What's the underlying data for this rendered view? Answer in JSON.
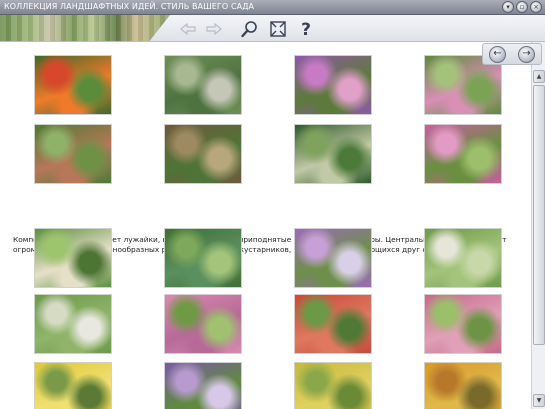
{
  "window": {
    "title": "КОЛЛЕКЦИЯ ЛАНДШАФТНЫХ ИДЕЙ. СТИЛЬ ВАШЕГО САДА",
    "controls": [
      {
        "name": "minimize-button",
        "glyph": "▾"
      },
      {
        "name": "restore-button",
        "glyph": "▫"
      },
      {
        "name": "close-button",
        "glyph": "×"
      }
    ]
  },
  "toolbar": {
    "tools": [
      {
        "name": "back-arrow-icon",
        "glyph": "⇦"
      },
      {
        "name": "forward-arrow-icon",
        "glyph": "⇨"
      },
      {
        "name": "zoom-magnifier-icon"
      },
      {
        "name": "fullscreen-icon"
      },
      {
        "name": "help-question-icon",
        "glyph": "?"
      }
    ]
  },
  "navigation": {
    "prev_glyph": "←",
    "next_glyph": "→"
  },
  "description": "Композиция сада включает лужайки, водоем с лилиями, приподнятые клумбы, миксбордеры. Центральную часть наполняет огромное количество разнообразных растений, цветов и кустарников, гармонично сочетающихся друг с другом.",
  "gallery": {
    "top_rows": [
      [
        {
          "name": "photo-red-hot-pokers",
          "colors": [
            "#3f6a2a",
            "#d9472b",
            "#f07a2a",
            "#5b8c3a"
          ]
        },
        {
          "name": "photo-garden-pond",
          "colors": [
            "#6f8f55",
            "#a8b892",
            "#4f7340",
            "#c5c7b6"
          ]
        },
        {
          "name": "photo-pink-asters",
          "colors": [
            "#8d5aa8",
            "#c77bc4",
            "#5d7a3a",
            "#e0a0c8"
          ]
        },
        {
          "name": "photo-border-lawn",
          "colors": [
            "#5f8a3f",
            "#a5c27a",
            "#d98fb6",
            "#7aa356"
          ]
        }
      ],
      [
        {
          "name": "photo-box-hedge-parterre",
          "colors": [
            "#4f7a35",
            "#8fb26a",
            "#b77758",
            "#6d9246"
          ]
        },
        {
          "name": "photo-raised-beds",
          "colors": [
            "#6e5a3c",
            "#9e8a62",
            "#4f7436",
            "#b8a77e"
          ]
        },
        {
          "name": "photo-cypress-pond",
          "colors": [
            "#2f5a2e",
            "#7fa35c",
            "#c2c9a6",
            "#4d7a3a"
          ]
        },
        {
          "name": "photo-flower-mixborder",
          "colors": [
            "#c75ea0",
            "#e39ac4",
            "#6a8f40",
            "#9cbf6c"
          ]
        }
      ]
    ],
    "bottom_rows": [
      [
        {
          "name": "photo-grass-path-border",
          "colors": [
            "#5d8f3f",
            "#9cc56e",
            "#e6e0c8",
            "#4c7433"
          ]
        },
        {
          "name": "photo-waterside-planting",
          "colors": [
            "#3f6f33",
            "#7ea85a",
            "#5a8f5f",
            "#a3c47a"
          ]
        },
        {
          "name": "photo-allium-border",
          "colors": [
            "#9a6bb8",
            "#c8a0d8",
            "#6e8f4a",
            "#d8d0e6"
          ]
        },
        {
          "name": "photo-white-perennials",
          "colors": [
            "#6e9a48",
            "#e6e6d8",
            "#a3c47a",
            "#c8d8a8"
          ]
        }
      ],
      [
        {
          "name": "photo-lawn-walk",
          "colors": [
            "#6d9a4a",
            "#d6dcc4",
            "#8fb46a",
            "#e8e8e0"
          ]
        },
        {
          "name": "photo-pink-astilbe",
          "colors": [
            "#d88ab0",
            "#6f9a45",
            "#b76a98",
            "#9fc170"
          ]
        },
        {
          "name": "photo-red-bloom-bed",
          "colors": [
            "#c84a3a",
            "#6a9a45",
            "#e07860",
            "#4f7a35"
          ]
        },
        {
          "name": "photo-pink-shrub-lawn",
          "colors": [
            "#c76a8a",
            "#9ac06a",
            "#e0a0b8",
            "#6d9445"
          ]
        }
      ],
      [
        {
          "name": "photo-yellow-spires",
          "colors": [
            "#e0c83a",
            "#7a9a48",
            "#f0e070",
            "#5a7a35"
          ]
        },
        {
          "name": "photo-purple-clematis",
          "colors": [
            "#7a5aa8",
            "#b89ad0",
            "#5f8a3f",
            "#d8c8e8"
          ]
        },
        {
          "name": "photo-golden-foliage",
          "colors": [
            "#c8b83a",
            "#8aa84a",
            "#e0d060",
            "#6a8a35"
          ]
        },
        {
          "name": "photo-amber-shrubs",
          "colors": [
            "#d89a2a",
            "#b8782a",
            "#e0b84a",
            "#7a6a2a"
          ]
        }
      ]
    ]
  }
}
